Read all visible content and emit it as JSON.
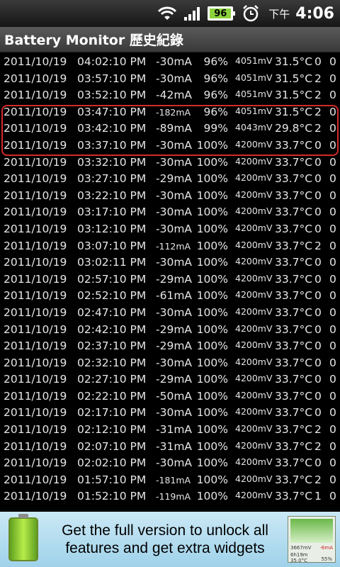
{
  "status_bar": {
    "battery_level": "96",
    "ampm": "下午",
    "time": "4:06",
    "icons": [
      "wifi-icon",
      "signal-icon",
      "battery-icon",
      "alarm-icon"
    ]
  },
  "title_bar": {
    "title": "Battery Monitor 歷史紀錄"
  },
  "log_rows": [
    {
      "date": "2011/10/19",
      "time": "04:02:10 PM",
      "current": "-30mA",
      "pct": "96%",
      "volt": "4051mV",
      "temp": "31.5°C",
      "a": "0",
      "b": "0"
    },
    {
      "date": "2011/10/19",
      "time": "03:57:10 PM",
      "current": "-30mA",
      "pct": "96%",
      "volt": "4051mV",
      "temp": "31.5°C",
      "a": "2",
      "b": "0"
    },
    {
      "date": "2011/10/19",
      "time": "03:52:10 PM",
      "current": "-42mA",
      "pct": "96%",
      "volt": "4051mV",
      "temp": "31.5°C",
      "a": "2",
      "b": "0"
    },
    {
      "date": "2011/10/19",
      "time": "03:47:10 PM",
      "current": "-182mA",
      "pct": "96%",
      "volt": "4051mV",
      "temp": "31.5°C",
      "a": "2",
      "b": "0"
    },
    {
      "date": "2011/10/19",
      "time": "03:42:10 PM",
      "current": "-89mA",
      "pct": "99%",
      "volt": "4043mV",
      "temp": "29.8°C",
      "a": "2",
      "b": "0"
    },
    {
      "date": "2011/10/19",
      "time": "03:37:10 PM",
      "current": "-30mA",
      "pct": "100%",
      "volt": "4200mV",
      "temp": "33.7°C",
      "a": "0",
      "b": "0"
    },
    {
      "date": "2011/10/19",
      "time": "03:32:10 PM",
      "current": "-30mA",
      "pct": "100%",
      "volt": "4200mV",
      "temp": "33.7°C",
      "a": "0",
      "b": "0"
    },
    {
      "date": "2011/10/19",
      "time": "03:27:10 PM",
      "current": "-29mA",
      "pct": "100%",
      "volt": "4200mV",
      "temp": "33.7°C",
      "a": "0",
      "b": "0"
    },
    {
      "date": "2011/10/19",
      "time": "03:22:10 PM",
      "current": "-30mA",
      "pct": "100%",
      "volt": "4200mV",
      "temp": "33.7°C",
      "a": "0",
      "b": "0"
    },
    {
      "date": "2011/10/19",
      "time": "03:17:10 PM",
      "current": "-30mA",
      "pct": "100%",
      "volt": "4200mV",
      "temp": "33.7°C",
      "a": "0",
      "b": "0"
    },
    {
      "date": "2011/10/19",
      "time": "03:12:10 PM",
      "current": "-30mA",
      "pct": "100%",
      "volt": "4200mV",
      "temp": "33.7°C",
      "a": "0",
      "b": "0"
    },
    {
      "date": "2011/10/19",
      "time": "03:07:10 PM",
      "current": "-112mA",
      "pct": "100%",
      "volt": "4200mV",
      "temp": "33.7°C",
      "a": "2",
      "b": "0"
    },
    {
      "date": "2011/10/19",
      "time": "03:02:11 PM",
      "current": "-30mA",
      "pct": "100%",
      "volt": "4200mV",
      "temp": "33.7°C",
      "a": "0",
      "b": "0"
    },
    {
      "date": "2011/10/19",
      "time": "02:57:10 PM",
      "current": "-29mA",
      "pct": "100%",
      "volt": "4200mV",
      "temp": "33.7°C",
      "a": "0",
      "b": "0"
    },
    {
      "date": "2011/10/19",
      "time": "02:52:10 PM",
      "current": "-61mA",
      "pct": "100%",
      "volt": "4200mV",
      "temp": "33.7°C",
      "a": "0",
      "b": "0"
    },
    {
      "date": "2011/10/19",
      "time": "02:47:10 PM",
      "current": "-30mA",
      "pct": "100%",
      "volt": "4200mV",
      "temp": "33.7°C",
      "a": "0",
      "b": "0"
    },
    {
      "date": "2011/10/19",
      "time": "02:42:10 PM",
      "current": "-29mA",
      "pct": "100%",
      "volt": "4200mV",
      "temp": "33.7°C",
      "a": "0",
      "b": "0"
    },
    {
      "date": "2011/10/19",
      "time": "02:37:10 PM",
      "current": "-29mA",
      "pct": "100%",
      "volt": "4200mV",
      "temp": "33.7°C",
      "a": "0",
      "b": "0"
    },
    {
      "date": "2011/10/19",
      "time": "02:32:10 PM",
      "current": "-30mA",
      "pct": "100%",
      "volt": "4200mV",
      "temp": "33.7°C",
      "a": "0",
      "b": "0"
    },
    {
      "date": "2011/10/19",
      "time": "02:27:10 PM",
      "current": "-29mA",
      "pct": "100%",
      "volt": "4200mV",
      "temp": "33.7°C",
      "a": "0",
      "b": "0"
    },
    {
      "date": "2011/10/19",
      "time": "02:22:10 PM",
      "current": "-50mA",
      "pct": "100%",
      "volt": "4200mV",
      "temp": "33.7°C",
      "a": "0",
      "b": "0"
    },
    {
      "date": "2011/10/19",
      "time": "02:17:10 PM",
      "current": "-30mA",
      "pct": "100%",
      "volt": "4200mV",
      "temp": "33.7°C",
      "a": "0",
      "b": "0"
    },
    {
      "date": "2011/10/19",
      "time": "02:12:10 PM",
      "current": "-31mA",
      "pct": "100%",
      "volt": "4200mV",
      "temp": "33.7°C",
      "a": "2",
      "b": "0"
    },
    {
      "date": "2011/10/19",
      "time": "02:07:10 PM",
      "current": "-31mA",
      "pct": "100%",
      "volt": "4200mV",
      "temp": "33.7°C",
      "a": "2",
      "b": "0"
    },
    {
      "date": "2011/10/19",
      "time": "02:02:10 PM",
      "current": "-30mA",
      "pct": "100%",
      "volt": "4200mV",
      "temp": "33.7°C",
      "a": "0",
      "b": "0"
    },
    {
      "date": "2011/10/19",
      "time": "01:57:10 PM",
      "current": "-181mA",
      "pct": "100%",
      "volt": "4200mV",
      "temp": "33.7°C",
      "a": "2",
      "b": "0"
    },
    {
      "date": "2011/10/19",
      "time": "01:52:10 PM",
      "current": "-119mA",
      "pct": "100%",
      "volt": "4200mV",
      "temp": "33.7°C",
      "a": "1",
      "b": "0"
    }
  ],
  "highlight_color": "#d32a2a",
  "ad": {
    "line1": "Get the full version to unlock all",
    "line2": "features and get extra widgets",
    "widget_volt": "3667mV",
    "widget_current": "-6mA",
    "widget_sub": "6h19m",
    "widget_temp": "35.0°C",
    "widget_pct": "55%"
  }
}
